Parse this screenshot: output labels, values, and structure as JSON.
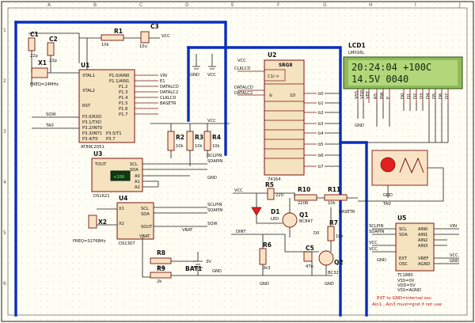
{
  "frame": {
    "columns": [
      "A",
      "B",
      "C",
      "D",
      "E",
      "F",
      "G",
      "H",
      "I",
      "J"
    ],
    "rows": [
      "1",
      "2",
      "3",
      "4",
      "5",
      "6"
    ]
  },
  "components": {
    "c1": {
      "ref": "C1",
      "value": "22p"
    },
    "c2": {
      "ref": "C2",
      "value": "22p"
    },
    "x1": {
      "ref": "X1",
      "value": "FREQ=24MHz"
    },
    "r1": {
      "ref": "R1",
      "value": "10k"
    },
    "c3": {
      "ref": "C3",
      "value": "10u"
    },
    "u1": {
      "ref": "U1",
      "part": "AT89C2051",
      "left_pins": [
        "XTAL1",
        "XTAL2",
        "RST",
        "P3.0/RXD",
        "P3.1/TXD",
        "P3.2/INT0",
        "P3.3/INT1",
        "P3.4/T0",
        "P3.5/T1",
        "P3.7"
      ],
      "right_pins": [
        "P1.0/AIN0",
        "P1.1/AIN1",
        "P1.2",
        "P1.3",
        "P1.4",
        "P1.5",
        "P1.6",
        "P1.7"
      ]
    },
    "u2": {
      "ref": "U2",
      "part": "74164",
      "header": "SRG8",
      "pins_left": [
        "C1/->",
        "&",
        "1D"
      ],
      "outputs": [
        "b0",
        "b1",
        "b2",
        "b3",
        "b4",
        "b5",
        "b6",
        "b7"
      ]
    },
    "u3": {
      "ref": "U3",
      "part": "DS1621",
      "pins": [
        "TOUT",
        "SCL",
        "SDA",
        "A0",
        "A1",
        "A2"
      ],
      "temp": "+100"
    },
    "u4": {
      "ref": "U4",
      "part": "DS1307",
      "pins": [
        "X1",
        "X2",
        "VBAT",
        "SCL",
        "SDA",
        "SOUT"
      ]
    },
    "u5": {
      "ref": "U5",
      "part": "TC1880",
      "pins": [
        "SCL",
        "SDA",
        "AIN0",
        "AIN1",
        "AIN2",
        "AIN3",
        "VREF",
        "AGND",
        "EXT",
        "OSC"
      ],
      "notes": [
        "VSS=0V",
        "VDD=5V",
        "VSS=AGND"
      ]
    },
    "x2": {
      "ref": "X2",
      "value": "FREQ=32768Hz"
    },
    "r2": {
      "ref": "R2",
      "value": "10k"
    },
    "r3": {
      "ref": "R3",
      "value": "10k"
    },
    "r4": {
      "ref": "R4",
      "value": "10k"
    },
    "r5": {
      "ref": "R5",
      "value": "220"
    },
    "r6": {
      "ref": "R6",
      "value": "3k3"
    },
    "r7": {
      "ref": "R7",
      "value": "10k"
    },
    "r8": {
      "ref": "R8",
      "value": "3k3"
    },
    "r9": {
      "ref": "R9",
      "value": "2k"
    },
    "r10": {
      "ref": "R10",
      "value": "220R"
    },
    "r11": {
      "ref": "R11",
      "value": "10k"
    },
    "c5": {
      "ref": "C5",
      "value": "47n"
    },
    "q1": {
      "ref": "Q1",
      "value": "BC847"
    },
    "q2": {
      "ref": "Q2",
      "value": "BC327"
    },
    "d1": {
      "ref": "D1",
      "value": "LED"
    },
    "bat1": {
      "ref": "BAT1",
      "value": "3V"
    },
    "lcd1": {
      "ref": "LCD1",
      "part": "LM016L",
      "line1": "20:24:04 +100C",
      "line2": "14.5V  0040",
      "pins": [
        "VSS",
        "VDD",
        "VEE",
        "RS",
        "RW",
        "E",
        "D0",
        "D1",
        "D2",
        "D3",
        "D4",
        "D5",
        "D6",
        "D7"
      ]
    }
  },
  "nets": {
    "vcc": "VCC",
    "gnd": "GND",
    "scl": "SCLPIN",
    "sda": "SDAPIN",
    "sqw": "SQW",
    "ta0": "TA0",
    "datalcd": "DATALCD",
    "clklcd": "CLKLCD",
    "datalc2": "DATALC2",
    "basetr": "BASETR",
    "vin": "VIN",
    "e1": "E1",
    "r1n": "R1",
    "d0": "D0",
    "dint": "DINT",
    "vbat": "VBAT"
  },
  "pin_labels": [
    "D0",
    "D1",
    "D2",
    "D3",
    "D4",
    "D5",
    "D6",
    "D7",
    "RS",
    "RW",
    "E",
    "AIN0",
    "AIN1",
    "AIN2",
    "AIN3"
  ],
  "note": {
    "line1": "EXT to GND=internal osc.",
    "line2": "Ain1...Ain3 must=gnd if not use"
  },
  "colors": {
    "wire": "#1a1a1a",
    "bus": "#0a2dbf",
    "chip": "#f5e2bf",
    "lcd_screen": "#b2d67a",
    "note": "#c01010"
  }
}
